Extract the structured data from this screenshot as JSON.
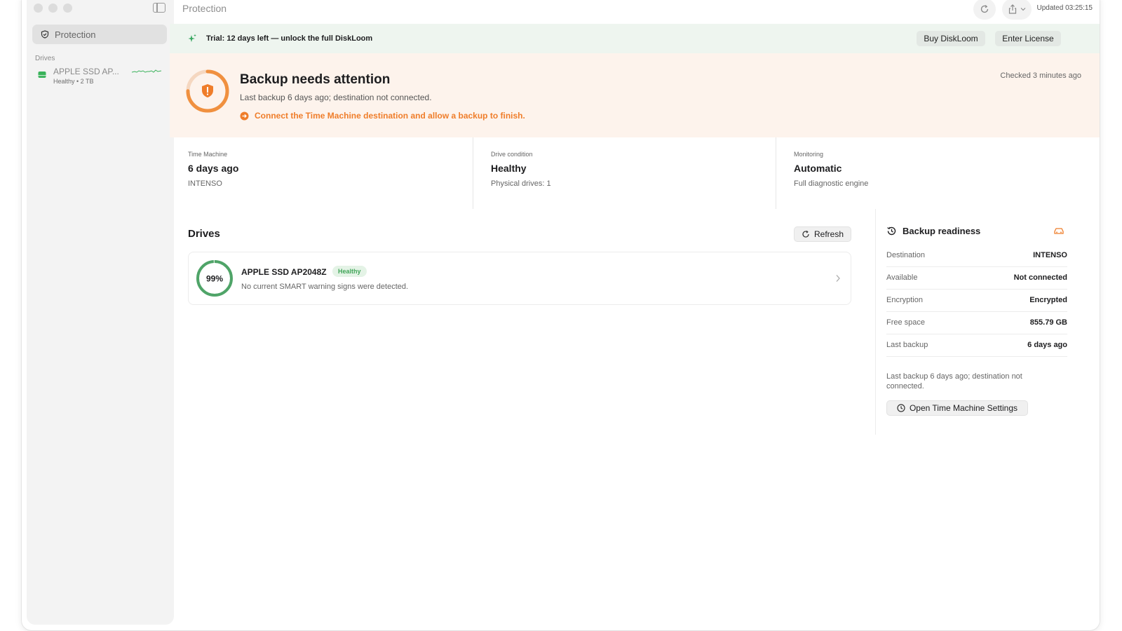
{
  "window": {
    "title": "Protection",
    "updated": "Updated 03:25:15"
  },
  "sidebar": {
    "nav": [
      {
        "label": "Protection",
        "icon": "shield-check-icon"
      }
    ],
    "section_label": "Drives",
    "drives": [
      {
        "name": "APPLE SSD AP...",
        "status": "Healthy",
        "size": "2 TB",
        "icon": "disk-icon"
      }
    ]
  },
  "trial": {
    "text": "Trial: 12 days left — unlock the full DiskLoom",
    "buy_label": "Buy DiskLoom",
    "license_label": "Enter License"
  },
  "attention": {
    "title": "Backup needs attention",
    "subtitle": "Last backup 6 days ago; destination not connected.",
    "action": "Connect the Time Machine destination and allow a backup to finish.",
    "checked": "Checked 3 minutes ago",
    "accent": "#ef7d2a"
  },
  "stats": [
    {
      "label": "Time Machine",
      "value": "6 days ago",
      "detail": "INTENSO"
    },
    {
      "label": "Drive condition",
      "value": "Healthy",
      "detail": "Physical drives: 1"
    },
    {
      "label": "Monitoring",
      "value": "Automatic",
      "detail": "Full diagnostic engine"
    }
  ],
  "drives": {
    "title": "Drives",
    "refresh_label": "Refresh",
    "items": [
      {
        "health_value": 99,
        "health": "99%",
        "name": "APPLE SSD AP2048Z",
        "badge": "Healthy",
        "description": "No current SMART warning signs were detected."
      }
    ]
  },
  "readiness": {
    "title": "Backup readiness",
    "rows": [
      {
        "key": "Destination",
        "value": "INTENSO"
      },
      {
        "key": "Available",
        "value": "Not connected"
      },
      {
        "key": "Encryption",
        "value": "Encrypted"
      },
      {
        "key": "Free space",
        "value": "855.79 GB"
      },
      {
        "key": "Last backup",
        "value": "6 days ago"
      }
    ],
    "note": "Last backup 6 days ago; destination not connected.",
    "button_label": "Open Time Machine Settings"
  },
  "colors": {
    "healthy": "#43a65a",
    "warning": "#ef7d2a"
  }
}
